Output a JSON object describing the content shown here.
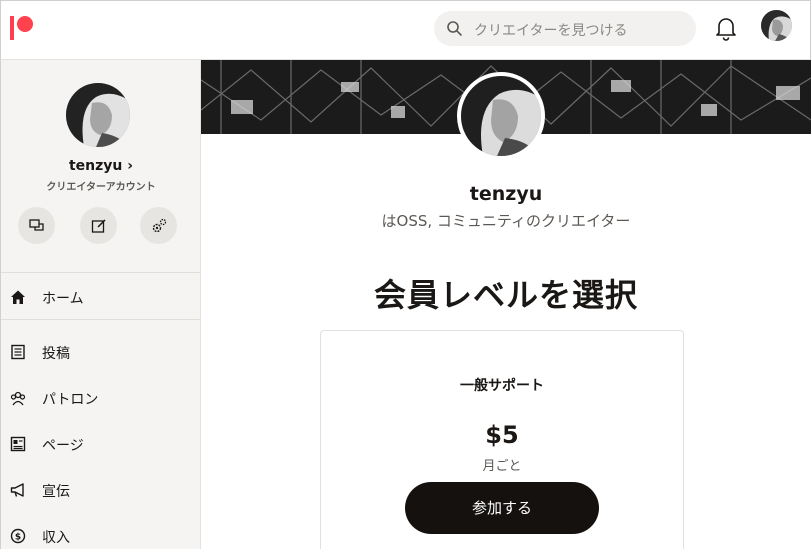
{
  "header": {
    "search_placeholder": "クリエイターを見つける"
  },
  "sidebar": {
    "profile_name": "tenzyu",
    "profile_chevron": "›",
    "account_type": "クリエイターアカウント",
    "quick_actions": [
      "messages",
      "edit",
      "settings"
    ],
    "nav": [
      {
        "label": "ホーム",
        "icon": "home-icon"
      },
      {
        "label": "投稿",
        "icon": "posts-icon"
      },
      {
        "label": "パトロン",
        "icon": "patrons-icon"
      },
      {
        "label": "ページ",
        "icon": "page-icon"
      },
      {
        "label": "宣伝",
        "icon": "promote-icon"
      },
      {
        "label": "収入",
        "icon": "income-icon"
      }
    ]
  },
  "main": {
    "creator_name": "tenzyu",
    "creator_description": "はOSS, コミュニティのクリエイター",
    "tier_heading": "会員レベルを選択",
    "tier": {
      "name": "一般サポート",
      "price": "$5",
      "period": "月ごと",
      "join_label": "参加する"
    }
  },
  "colors": {
    "brand": "#ff424d",
    "button_dark": "#14110f",
    "sidebar_bg": "#f5f4f2"
  }
}
